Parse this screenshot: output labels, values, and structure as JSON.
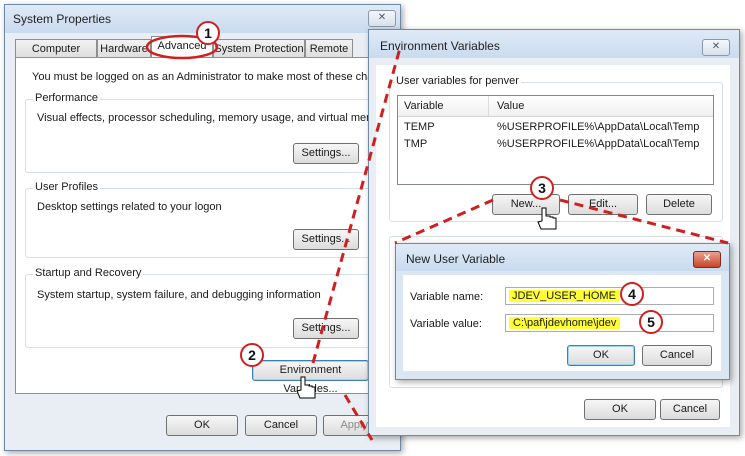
{
  "system_properties": {
    "title": "System Properties",
    "close_label": "✕",
    "tabs": [
      {
        "label": "Computer Name"
      },
      {
        "label": "Hardware"
      },
      {
        "label": "Advanced"
      },
      {
        "label": "System Protection"
      },
      {
        "label": "Remote"
      }
    ],
    "admin_notice": "You must be logged on as an Administrator to make most of these changes.",
    "performance": {
      "heading": "Performance",
      "description": "Visual effects, processor scheduling, memory usage, and virtual memory",
      "button": "Settings..."
    },
    "user_profiles": {
      "heading": "User Profiles",
      "description": "Desktop settings related to your logon",
      "button": "Settings..."
    },
    "startup_recovery": {
      "heading": "Startup and Recovery",
      "description": "System startup, system failure, and debugging information",
      "button": "Settings..."
    },
    "env_vars_button": "Environment Variables...",
    "ok": "OK",
    "cancel": "Cancel",
    "apply": "Apply"
  },
  "env_vars": {
    "title": "Environment Variables",
    "close_label": "✕",
    "user_section": "User variables for penver",
    "columns": [
      "Variable",
      "Value"
    ],
    "rows": [
      {
        "variable": "TEMP",
        "value": "%USERPROFILE%\\AppData\\Local\\Temp"
      },
      {
        "variable": "TMP",
        "value": "%USERPROFILE%\\AppData\\Local\\Temp"
      }
    ],
    "new_button": "New...",
    "edit_button": "Edit...",
    "delete_button": "Delete",
    "ok": "OK",
    "cancel": "Cancel"
  },
  "new_user_variable": {
    "title": "New User Variable",
    "close_label": "✕",
    "name_label": "Variable name:",
    "name_value": "JDEV_USER_HOME",
    "value_label": "Variable value:",
    "value_value": "C:\\paf\\jdevhome\\jdev",
    "ok": "OK",
    "cancel": "Cancel"
  },
  "annotations": {
    "steps": [
      "1",
      "2",
      "3",
      "4",
      "5"
    ],
    "color": "#d01f1f"
  }
}
